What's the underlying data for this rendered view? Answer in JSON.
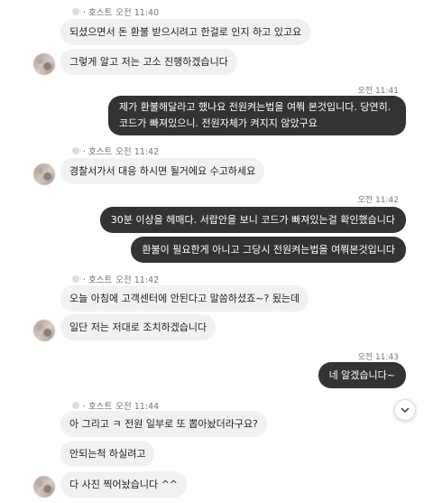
{
  "messages": [
    {
      "side": "left",
      "meta": {
        "name": "· 호스트",
        "time": "오전 11:40"
      },
      "text": "되셨으면서 돈 환불 받으시려고 한걸로 인지 하고 있고요"
    },
    {
      "side": "left",
      "text": "그렇게 알고 저는 고소 진행하겠습니다"
    },
    {
      "side": "right",
      "time": "오전 11:41",
      "text": "제가 환불해달라고 했나요 전원켜는법을 여쭤 본것입니다. 당연히. 코드가 빠져있으니. 전원자체가 켜지지 않았구요"
    },
    {
      "side": "left",
      "meta": {
        "name": "· 호스트",
        "time": "오전 11:42"
      },
      "text": "경찰서가서 대응 하시면 될거에요 수고하세요"
    },
    {
      "side": "right",
      "time": "오전 11:42",
      "text": "30분 이상을 헤매다. 서랍안을 보니 코드가 빠져있는걸 확인했습니다"
    },
    {
      "side": "right",
      "text": "환불이 필요한게 아니고 그당시 전원켜는법을 여쭤본것입니다"
    },
    {
      "side": "left",
      "meta": {
        "name": "· 호스트",
        "time": "오전 11:42"
      },
      "text": "오늘 아침에 고객센터에 안된다고 말씀하셨죠~? 됬는데"
    },
    {
      "side": "left",
      "text": "일단 저는 저대로 조치하겠습니다"
    },
    {
      "side": "right",
      "time": "오전 11:43",
      "text": "네 알겠습니다~"
    },
    {
      "side": "left",
      "meta": {
        "name": "· 호스트",
        "time": "오전 11:44"
      },
      "text": "아 그리고 ㅋ 전원 일부로 또 뽑아놨더라구요?"
    },
    {
      "side": "left",
      "text": "안되는척 하실려고"
    },
    {
      "side": "left",
      "text": "다 사진 찍어놨습니다 ^^"
    }
  ],
  "icons": {
    "scroll_down": "chevron-down-icon"
  }
}
